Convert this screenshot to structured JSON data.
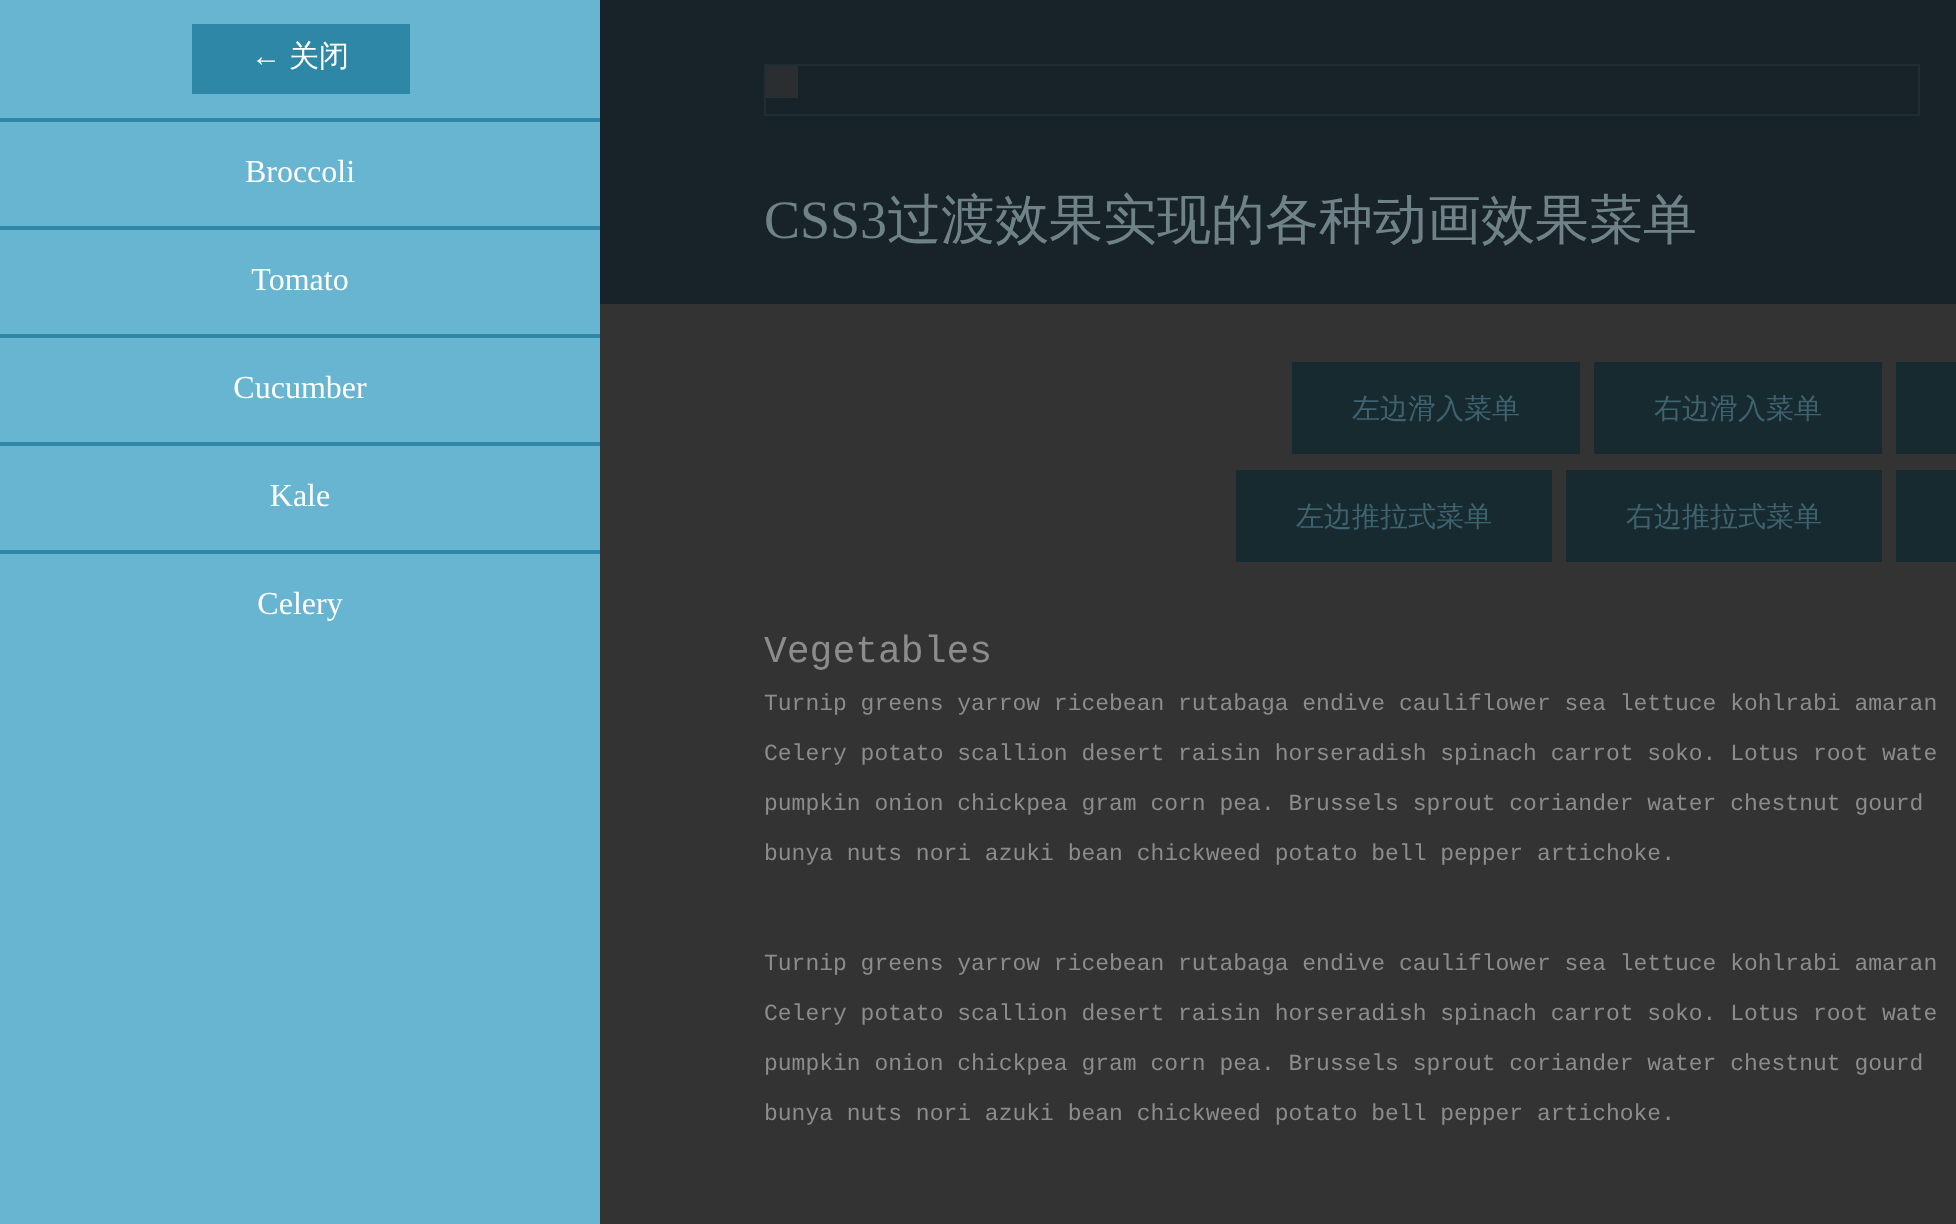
{
  "sidebar": {
    "close_button": {
      "icon": "←",
      "label": "关闭"
    },
    "items": [
      {
        "label": "Broccoli"
      },
      {
        "label": "Tomato"
      },
      {
        "label": "Cucumber"
      },
      {
        "label": "Kale"
      },
      {
        "label": "Celery"
      }
    ]
  },
  "header": {
    "title": "CSS3过渡效果实现的各种动画效果菜单"
  },
  "demo_buttons": [
    {
      "labels": [
        "左边滑入菜单",
        "右边滑入菜单"
      ],
      "cut_off_button": true
    },
    {
      "labels": [
        "左边推拉式菜单",
        "右边推拉式菜单"
      ],
      "cut_off_button": true
    }
  ],
  "content": {
    "heading": "Vegetables",
    "paragraphs": [
      [
        "Turnip greens yarrow ricebean rutabaga endive cauliflower sea lettuce kohlrabi amaran",
        "Celery potato scallion desert raisin horseradish spinach carrot soko. Lotus root wate",
        "pumpkin onion chickpea gram corn pea. Brussels sprout coriander water chestnut gourd",
        "bunya nuts nori azuki bean chickweed potato bell pepper artichoke."
      ],
      [
        "Turnip greens yarrow ricebean rutabaga endive cauliflower sea lettuce kohlrabi amaran",
        "Celery potato scallion desert raisin horseradish spinach carrot soko. Lotus root wate",
        "pumpkin onion chickpea gram corn pea. Brussels sprout coriander water chestnut gourd",
        "bunya nuts nori azuki bean chickweed potato bell pepper artichoke."
      ]
    ]
  }
}
